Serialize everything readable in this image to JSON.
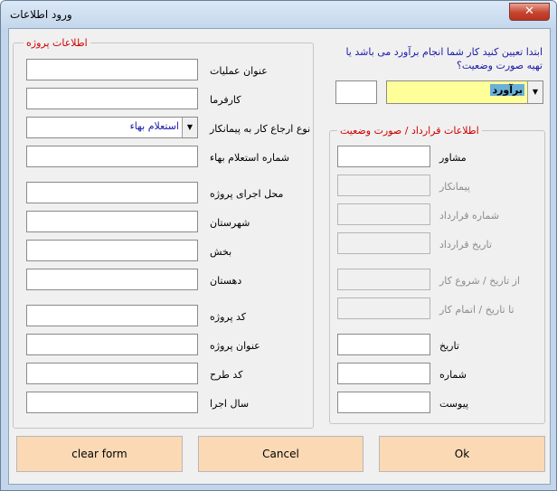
{
  "window": {
    "title": "ورود اطلاعات",
    "close_glyph": "✕"
  },
  "project_group": {
    "legend": "اطلاعات پروژه",
    "fields": [
      {
        "label": "عنوان عملیات",
        "value": ""
      },
      {
        "label": "کارفرما",
        "value": ""
      },
      {
        "label": "نوع ارجاع کار به پیمانکار",
        "value": "استعلام بهاء"
      },
      {
        "label": "شماره استعلام بهاء",
        "value": ""
      },
      {
        "label": "محل اجرای پروژه",
        "value": ""
      },
      {
        "label": "شهرستان",
        "value": ""
      },
      {
        "label": "بخش",
        "value": ""
      },
      {
        "label": "دهستان",
        "value": ""
      },
      {
        "label": "کد پروژه",
        "value": ""
      },
      {
        "label": "عنوان پروژه",
        "value": ""
      },
      {
        "label": "کد طرح",
        "value": ""
      },
      {
        "label": "سال اجرا",
        "value": ""
      }
    ]
  },
  "instruction": "ابتدا تعیین کنید کار شما انجام برآورد می باشد یا تهیه صورت وضعیت؟",
  "type_select": {
    "value": "برآورد",
    "small_box": ""
  },
  "contract_group": {
    "legend": "اطلاعات قرارداد / صورت وضعیت",
    "fields": [
      {
        "label": "مشاور",
        "value": "",
        "enabled": true
      },
      {
        "label": "پیمانکار",
        "value": "",
        "enabled": false
      },
      {
        "label": "شماره قرارداد",
        "value": "",
        "enabled": false
      },
      {
        "label": "تاریخ قرارداد",
        "value": "",
        "enabled": false
      },
      {
        "label": "از تاریخ / شروع کار",
        "value": "",
        "enabled": false
      },
      {
        "label": "تا تاریخ / اتمام کار",
        "value": "",
        "enabled": false
      },
      {
        "label": "تاریخ",
        "value": "",
        "enabled": true
      },
      {
        "label": "شماره",
        "value": "",
        "enabled": true
      },
      {
        "label": "پیوست",
        "value": "",
        "enabled": true
      }
    ]
  },
  "buttons": {
    "clear": "clear form",
    "cancel": "Cancel",
    "ok": "Ok"
  },
  "colors": {
    "button_bg": "#fcd9b5",
    "select_bg": "#ffff99",
    "legend_text": "#d00000",
    "instruction_text": "#1a1aa8"
  }
}
